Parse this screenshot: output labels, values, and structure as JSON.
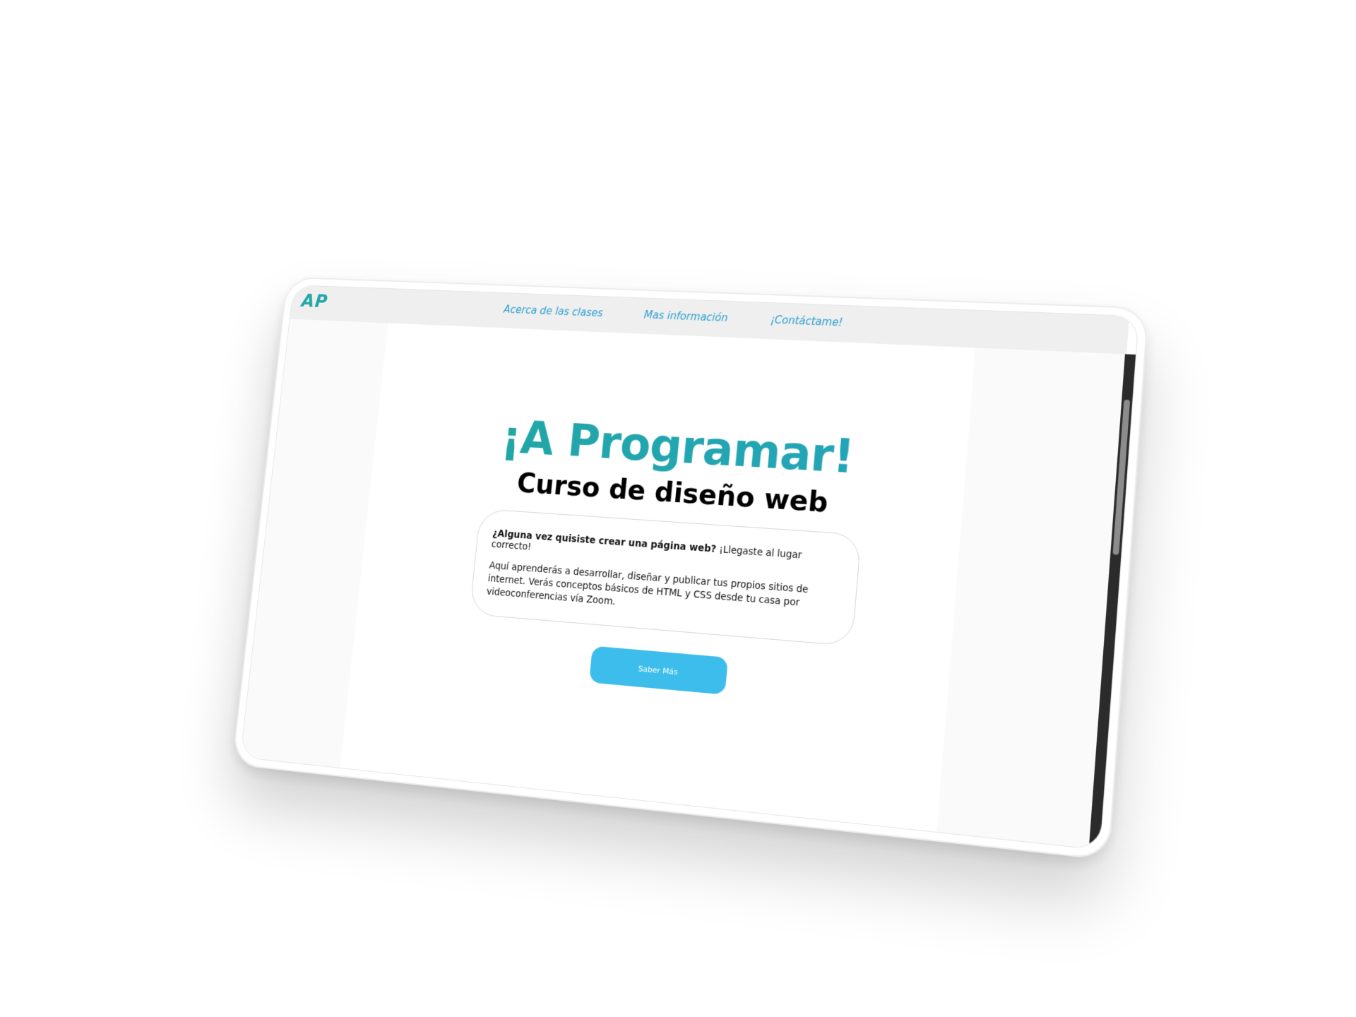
{
  "navbar": {
    "logo": "AP",
    "links": [
      "Acerca de las clases",
      "Mas información",
      "¡Contáctame!"
    ]
  },
  "hero": {
    "title": "¡A Programar!",
    "subtitle": "Curso de diseño web"
  },
  "card": {
    "question": "¿Alguna vez quisiste crear una página web?",
    "answer": "¡Llegaste al lugar correcto!",
    "description": "Aquí aprenderás a desarrollar, diseñar y publicar tus propios sitios de internet. Verás conceptos básicos de HTML y CSS desde tu casa por videoconferencias vía Zoom."
  },
  "cta": {
    "label": "Saber Más"
  },
  "colors": {
    "brand": "#22a6a7",
    "link": "#2a9fd0",
    "button": "#3dbdec",
    "navbar_bg": "#efefef",
    "scrollbar": "#2b2b2b"
  }
}
